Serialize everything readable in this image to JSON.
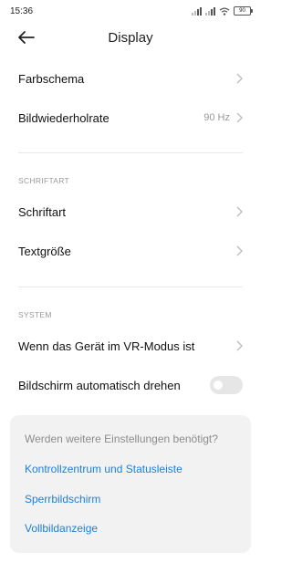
{
  "status": {
    "time": "15:36",
    "battery": "90"
  },
  "header": {
    "title": "Display"
  },
  "rows": {
    "farbschema": "Farbschema",
    "bildwiederholrate": "Bildwiederholrate",
    "bildwiederholrate_value": "90 Hz",
    "schriftart": "Schriftart",
    "textgroesse": "Textgröße",
    "vr_modus": "Wenn das Gerät im VR-Modus ist",
    "auto_rotate": "Bildschirm automatisch drehen"
  },
  "sections": {
    "schriftart": "SCHRIFTART",
    "system": "SYSTEM"
  },
  "auto_rotate_on": false,
  "card": {
    "question": "Werden weitere Einstellungen benötigt?",
    "links": [
      "Kontrollzentrum und Statusleiste",
      "Sperrbildschirm",
      "Vollbildanzeige"
    ]
  },
  "colors": {
    "link": "#1e7fd8",
    "card_bg": "#f2f2f2"
  },
  "icons": [
    "back-arrow-icon",
    "chevron-right-icon",
    "signal-icon",
    "wifi-icon",
    "battery-icon"
  ]
}
